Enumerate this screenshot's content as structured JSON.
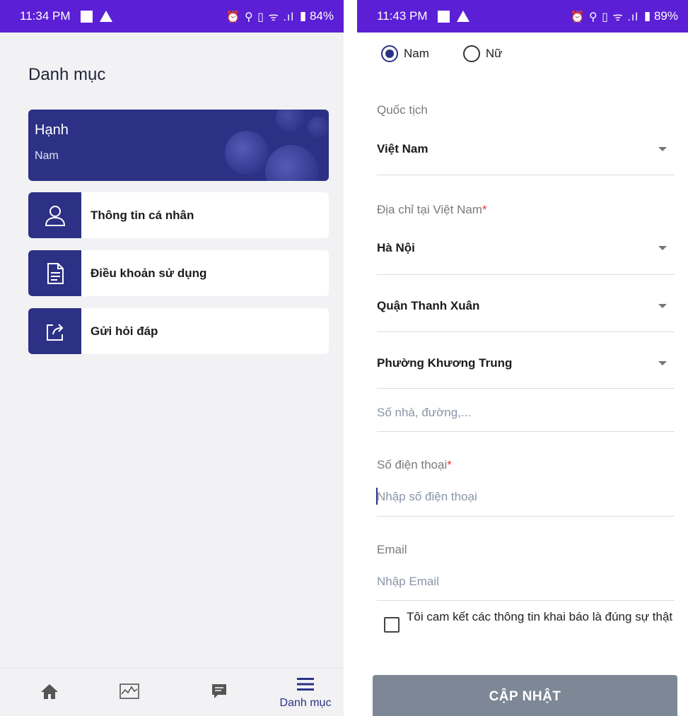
{
  "left": {
    "statusbar": {
      "time": "11:34 PM",
      "icons": "⏰ ⚲ ▯ ᯤ .ıl",
      "battery": "▮ 84%"
    },
    "title": "Danh mục",
    "profile": {
      "name": "Hạnh",
      "subtitle": "Nam"
    },
    "menu": [
      {
        "label": "Thông tin cá nhân",
        "icon": "user-icon"
      },
      {
        "label": "Điều khoản sử dụng",
        "icon": "document-icon"
      },
      {
        "label": "Gửi hỏi đáp",
        "icon": "share-icon"
      }
    ],
    "bottom_nav": {
      "items": [
        {
          "icon": "home-icon"
        },
        {
          "icon": "chart-icon"
        },
        {
          "icon": "message-icon"
        },
        {
          "icon": "menu-icon",
          "label": "Danh mục",
          "active": true
        }
      ]
    }
  },
  "right": {
    "statusbar": {
      "time": "11:43 PM",
      "icons": "⏰ ⚲ ▯ ᯤ .ıl",
      "battery": "▮ 89%"
    },
    "gender": {
      "options": [
        "Nam",
        "Nữ"
      ],
      "selected": "Nam"
    },
    "nationality": {
      "label": "Quốc tịch",
      "value": "Việt Nam"
    },
    "address": {
      "label": "Địa chỉ tại Việt Nam",
      "required": "*",
      "province": "Hà Nội",
      "district": "Quận Thanh Xuân",
      "ward": "Phường Khương Trung",
      "street_placeholder": "Số nhà, đường,..."
    },
    "phone": {
      "label": "Số điện thoại",
      "required": "*",
      "placeholder": "Nhập số điện thoại"
    },
    "email": {
      "label": "Email",
      "placeholder": "Nhập Email"
    },
    "commitment": "Tôi cam kết các thông tin khai báo là đúng sự thật",
    "submit_label": "CẬP NHẬT"
  },
  "colors": {
    "status_bar": "#5b1fd6",
    "primary": "#2c3185",
    "button_disabled": "#7d8796",
    "required": "#e53935"
  }
}
